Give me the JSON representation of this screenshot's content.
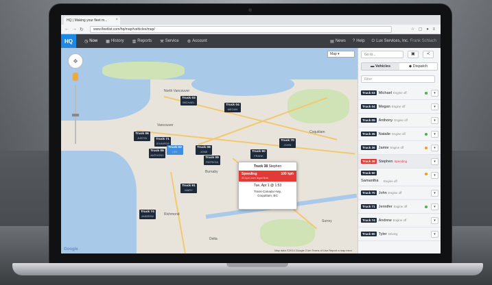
{
  "browser": {
    "tab_title": "HQ | Making your fleet m...",
    "url": "www.fleetlist.com/hq/map#vehicles/map/"
  },
  "app": {
    "logo": "HQ",
    "nav": [
      {
        "label": "Now",
        "icon": "clock-icon"
      },
      {
        "label": "History",
        "icon": "calendar-icon"
      },
      {
        "label": "Reports",
        "icon": "chart-icon"
      },
      {
        "label": "Service",
        "icon": "wrench-icon"
      },
      {
        "label": "Account",
        "icon": "gear-icon"
      }
    ],
    "right_nav": [
      {
        "label": "News",
        "icon": "news-icon"
      },
      {
        "label": "Help",
        "icon": "help-icon"
      },
      {
        "label": "Lux Services, Inc.",
        "icon": "power-icon"
      }
    ],
    "user_name": "Frank Schlach"
  },
  "map": {
    "maptype_label": "Map",
    "cities": [
      "North Vancouver",
      "Vancouver",
      "Burnaby",
      "Coquitlam",
      "Richmond",
      "Delta",
      "Surrey"
    ],
    "markers": [
      {
        "plate": "Truck 03",
        "driver": "MICHAEL"
      },
      {
        "plate": "Truck 04",
        "driver": "MEGAN"
      },
      {
        "plate": "Truck 06",
        "driver": "JUSTIN"
      },
      {
        "plate": "Truck 71",
        "driver": "JENNIFER"
      },
      {
        "plate": "Truck 05",
        "driver": "ANTHONY"
      },
      {
        "plate": "Truck 02",
        "driver": "LEE"
      },
      {
        "plate": "Truck 08",
        "driver": "JONE"
      },
      {
        "plate": "Truck 09",
        "driver": "PATRICIA"
      },
      {
        "plate": "Truck 90",
        "driver": "FRANK"
      },
      {
        "plate": "Truck 70",
        "driver": "JOHN"
      },
      {
        "plate": "Truck 91",
        "driver": "MARY"
      },
      {
        "plate": "Truck 74",
        "driver": "ANDREW"
      }
    ],
    "popup": {
      "title": "Truck 38",
      "driver": "Stephen",
      "alert_label": "Speeding",
      "alert_speed": "100 kph",
      "alert_detail": "20 kph over legal limit",
      "time": "Tue, Apr 1 @ 1:53",
      "address_line1": "Trans-Canada Hwy,",
      "address_line2": "Coquitlam, BC"
    },
    "footer": "Map data ©2014 Google    2 km    Terms of Use    Report a map error",
    "google_logo": "Google"
  },
  "sidebar": {
    "goto_placeholder": "Go to...",
    "tabs": [
      "Vehicles",
      "Dispatch"
    ],
    "filter_placeholder": "Filter",
    "vehicles": [
      {
        "plate": "Truck 03",
        "driver": "Michael",
        "status": "Engine off",
        "dot": "#43b649",
        "alert": false
      },
      {
        "plate": "Truck 04",
        "driver": "Megan",
        "status": "Engine off",
        "dot": "",
        "alert": false
      },
      {
        "plate": "Truck 05",
        "driver": "Anthony",
        "status": "Engine off",
        "dot": "",
        "alert": false
      },
      {
        "plate": "Truck 35",
        "driver": "Natalie",
        "status": "Engine off",
        "dot": "#43b649",
        "alert": false
      },
      {
        "plate": "Truck 36",
        "driver": "Jamie",
        "status": "Engine off",
        "dot": "#f39c12",
        "alert": false
      },
      {
        "plate": "Truck 38",
        "driver": "Stephen",
        "status": "Speeding",
        "dot": "",
        "alert": true
      },
      {
        "plate": "Truck 50",
        "driver": "Samantha",
        "status": "Engine off",
        "dot": "#f39c12",
        "alert": false
      },
      {
        "plate": "Truck 70",
        "driver": "John",
        "status": "Engine off",
        "dot": "",
        "alert": false
      },
      {
        "plate": "Truck 71",
        "driver": "Jennifer",
        "status": "Engine off",
        "dot": "#43b649",
        "alert": false
      },
      {
        "plate": "Truck 74",
        "driver": "Andrew",
        "status": "Engine off",
        "dot": "",
        "alert": false
      },
      {
        "plate": "Truck 90",
        "driver": "Tyler",
        "status": "Driving",
        "dot": "",
        "alert": false
      }
    ]
  },
  "colors": {
    "accent": "#1e88e5",
    "alert": "#e53935",
    "marker": "#1e2a3a"
  }
}
